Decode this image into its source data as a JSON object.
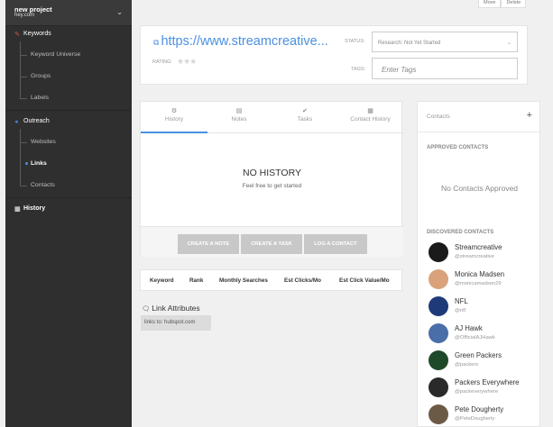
{
  "project": {
    "name": "new project",
    "domain": "hey.com"
  },
  "sidebar": {
    "keywords_label": "Keywords",
    "keyword_items": [
      "Keyword Universe",
      "Groups",
      "Labels"
    ],
    "outreach_label": "Outreach",
    "outreach_items": [
      "Websites",
      "Links",
      "Contacts"
    ],
    "history_label": "History"
  },
  "top_buttons": [
    "Move",
    "Delete"
  ],
  "header": {
    "url": "https://www.streamcreative...",
    "rating_label": "RATING:",
    "status_label": "STATUS:",
    "status_value": "Research: Not Yet Started",
    "tags_label": "TAGS:",
    "tags_placeholder": "Enter Tags"
  },
  "tabs": [
    "History",
    "Notes",
    "Tasks",
    "Contact History"
  ],
  "history": {
    "title": "NO HISTORY",
    "subtitle": "Feel free to get started"
  },
  "actions": [
    "CREATE A NOTE",
    "CREATE A TASK",
    "LOG A CONTACT"
  ],
  "keyword_columns": [
    "Keyword",
    "Rank",
    "Monthly Searches",
    "Est Clicks/Mo",
    "Est Click Value/Mo"
  ],
  "link_attributes": {
    "title": "Link Attributes",
    "chip": "links to: hubspot.com"
  },
  "contacts": {
    "title": "Contacts",
    "approved_title": "APPROVED CONTACTS",
    "no_approved": "No Contacts Approved",
    "discovered_title": "DISCOVERED CONTACTS",
    "discovered": [
      {
        "name": "Streamcreative",
        "handle": "@streamcreative",
        "color": "#1a1a1a"
      },
      {
        "name": "Monica Madsen",
        "handle": "@monicamadsen29",
        "color": "#d9a27a"
      },
      {
        "name": "NFL",
        "handle": "@nfl",
        "color": "#1e3a78"
      },
      {
        "name": "AJ Hawk",
        "handle": "@OfficialAJHawk",
        "color": "#4a6ea8"
      },
      {
        "name": "Green Packers",
        "handle": "@packers",
        "color": "#1f4a2a"
      },
      {
        "name": "Packers Everywhere",
        "handle": "@packeverywhere",
        "color": "#2a2a2a"
      },
      {
        "name": "Pete Dougherty",
        "handle": "@PeteDougherty",
        "color": "#6b5a46"
      }
    ]
  },
  "colors": {
    "accent": "#4a90e2",
    "sidebar": "#2f2f2f",
    "button_disabled": "#c8c8c8"
  }
}
